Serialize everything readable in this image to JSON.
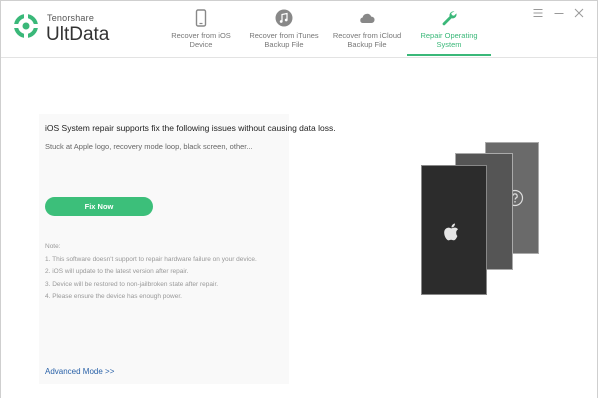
{
  "app": {
    "brand_small": "Tenorshare",
    "brand_name": "UltData",
    "accent_color": "#3ab879"
  },
  "tabs": [
    {
      "label": "Recover from iOS\nDevice",
      "icon": "phone-icon",
      "active": false
    },
    {
      "label": "Recover from iTunes\nBackup File",
      "icon": "music-note-icon",
      "active": false
    },
    {
      "label": "Recover from iCloud\nBackup File",
      "icon": "cloud-icon",
      "active": false
    },
    {
      "label": "Repair Operating\nSystem",
      "icon": "wrench-icon",
      "active": true
    }
  ],
  "window_controls": [
    "menu-icon",
    "minimize-icon",
    "close-icon"
  ],
  "main": {
    "heading": "iOS System repair supports fix the following issues without causing data loss.",
    "subheading": "Stuck at Apple logo, recovery mode loop, black screen, other...",
    "fix_button": "Fix Now",
    "fix_button_color": "#3cbf7a",
    "note_title": "Note:",
    "notes": [
      "1. This software doesn't support to repair hardware failure on your device.",
      "2. iOS will update to the latest version after repair.",
      "3. Device will be restored to non-jailbroken state after repair.",
      "4. Please ensure the device has enough power."
    ],
    "advanced_link": "Advanced Mode >>"
  }
}
